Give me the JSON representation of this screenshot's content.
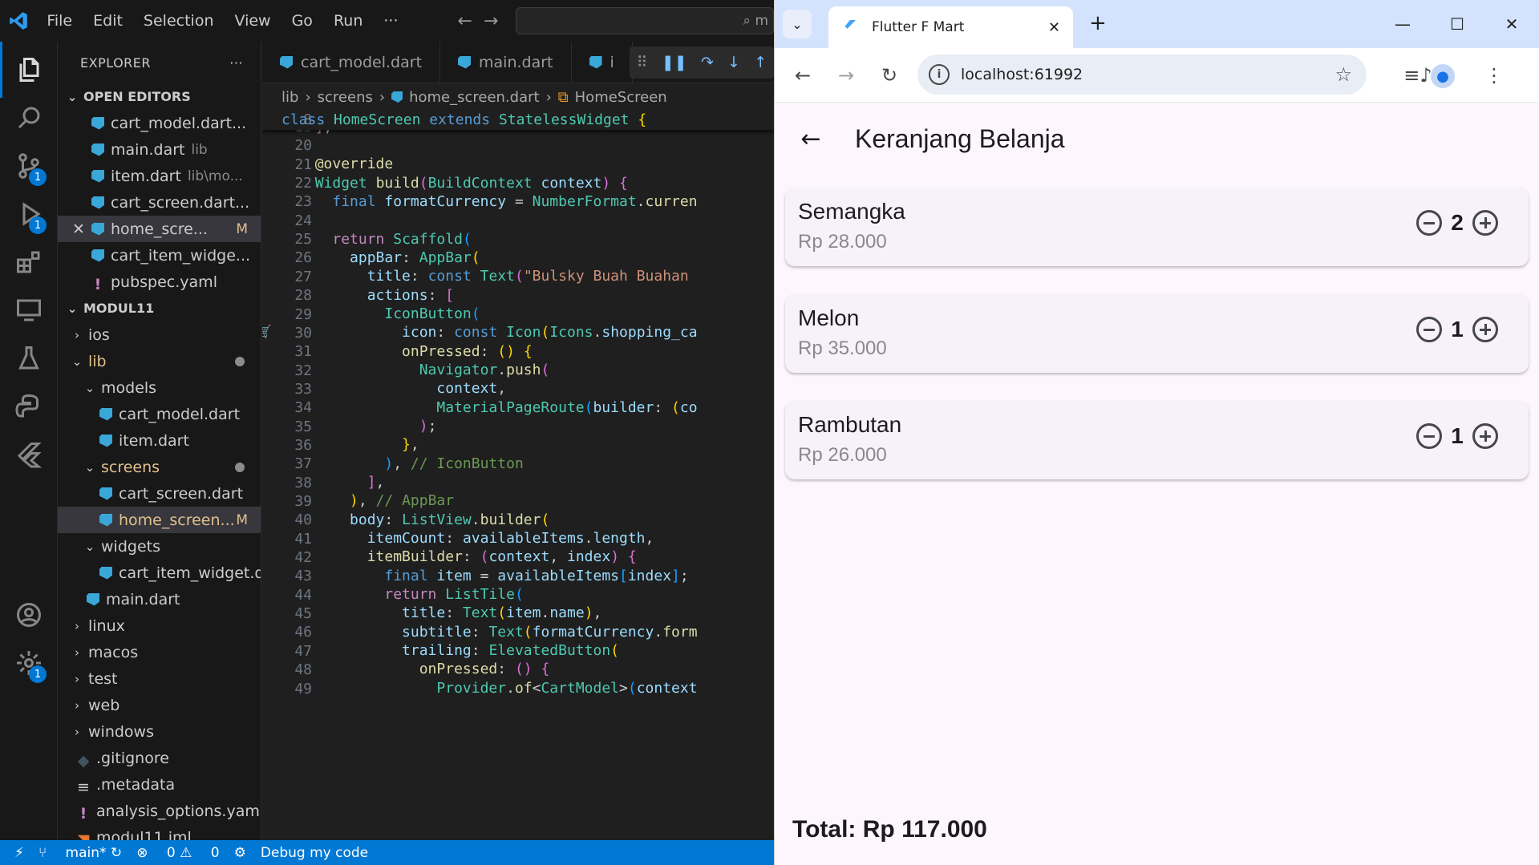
{
  "vscode": {
    "menu": [
      "File",
      "Edit",
      "Selection",
      "View",
      "Go",
      "Run",
      "···"
    ],
    "search_placeholder": "m",
    "activity_badges": {
      "scm": "1",
      "debug": "1",
      "settings": "1"
    },
    "explorer": {
      "title": "EXPLORER",
      "more": "···",
      "open_editors_label": "OPEN EDITORS",
      "open_editors": [
        {
          "name": "cart_model.dart...",
          "hint": ""
        },
        {
          "name": "main.dart",
          "hint": "lib"
        },
        {
          "name": "item.dart",
          "hint": "lib\\mo..."
        },
        {
          "name": "cart_screen.dart...",
          "hint": ""
        },
        {
          "name": "home_scre...",
          "hint": "M"
        },
        {
          "name": "cart_item_widge...",
          "hint": ""
        },
        {
          "name": "pubspec.yaml",
          "hint": ""
        }
      ],
      "project_label": "MODUL11",
      "tree": [
        "ios",
        "lib",
        "models",
        "cart_model.dart",
        "item.dart",
        "screens",
        "cart_screen.dart",
        "home_screen...",
        "widgets",
        "cart_item_widget.d...",
        "main.dart",
        "linux",
        "macos",
        "test",
        "web",
        "windows",
        ".gitignore",
        ".metadata",
        "analysis_options.yaml",
        "modul11.iml"
      ],
      "modified_mark": "M"
    },
    "tabs": [
      "cart_model.dart",
      "main.dart",
      "i"
    ],
    "breadcrumb": [
      "lib",
      "screens",
      "home_screen.dart",
      "HomeScreen"
    ],
    "sticky_line": {
      "num": "8",
      "text": "class HomeScreen extends StatelessWidget {"
    },
    "line_numbers": [
      "19",
      "20",
      "21",
      "22",
      "23",
      "24",
      "25",
      "26",
      "27",
      "28",
      "29",
      "30",
      "31",
      "32",
      "33",
      "34",
      "35",
      "36",
      "37",
      "38",
      "39",
      "40",
      "41",
      "42",
      "43",
      "44",
      "45",
      "46",
      "47",
      "48",
      "49"
    ],
    "status": {
      "branch": "main*",
      "errors": "0",
      "warnings": "0",
      "debug": "Debug my code"
    }
  },
  "browser": {
    "tab_title": "Flutter F Mart",
    "url": "localhost:61992",
    "app": {
      "title": "Keranjang Belanja",
      "items": [
        {
          "name": "Semangka",
          "price": "Rp 28.000",
          "qty": "2"
        },
        {
          "name": "Melon",
          "price": "Rp 35.000",
          "qty": "1"
        },
        {
          "name": "Rambutan",
          "price": "Rp 26.000",
          "qty": "1"
        }
      ],
      "total": "Total: Rp 117.000"
    }
  }
}
